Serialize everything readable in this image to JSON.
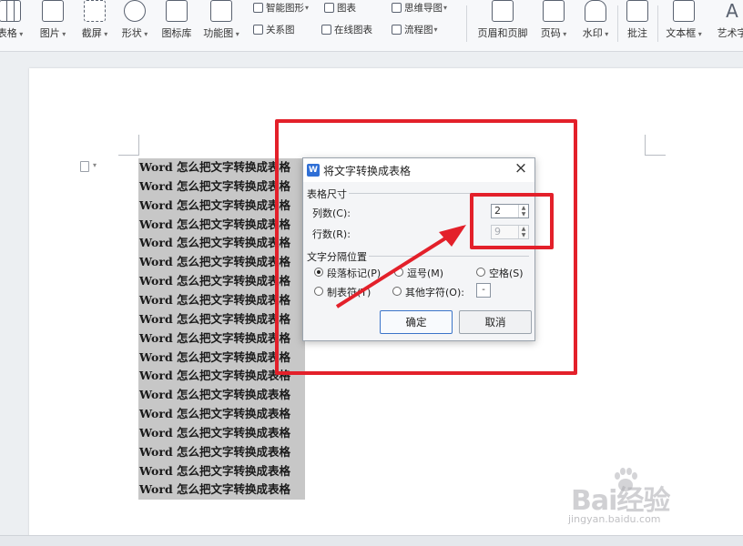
{
  "ribbon": {
    "items": [
      {
        "label": "表格",
        "icon": "table-icon"
      },
      {
        "label": "图片",
        "icon": "picture-icon"
      },
      {
        "label": "截屏",
        "icon": "screenshot-icon"
      },
      {
        "label": "形状",
        "icon": "shapes-icon"
      },
      {
        "label": "图标库",
        "icon": "icon-library-icon"
      },
      {
        "label": "功能图",
        "icon": "function-chart-icon"
      },
      {
        "label": "页眉和页脚",
        "icon": "header-footer-icon"
      },
      {
        "label": "页码",
        "icon": "page-number-icon"
      },
      {
        "label": "水印",
        "icon": "watermark-icon"
      },
      {
        "label": "批注",
        "icon": "comment-icon"
      },
      {
        "label": "文本框",
        "icon": "textbox-icon"
      },
      {
        "label": "艺术字",
        "icon": "wordart-icon"
      }
    ],
    "small": {
      "smart_graphic": "智能图形",
      "chart": "图表",
      "mind_map": "思维导图",
      "relation_chart": "关系图",
      "online_chart": "在线图表",
      "flowchart": "流程图"
    }
  },
  "document": {
    "line_text": "Word 怎么把文字转换成表格",
    "line_count": 18
  },
  "dialog": {
    "app_icon_text": "W",
    "title": "将文字转换成表格",
    "close": "×",
    "table_size_group": "表格尺寸",
    "columns_label": "列数(C):",
    "columns_value": "2",
    "rows_label": "行数(R):",
    "rows_value": "9",
    "separator_group": "文字分隔位置",
    "separators": {
      "paragraph": "段落标记(P)",
      "comma": "逗号(M)",
      "space": "空格(S)",
      "tab": "制表符(T)",
      "other": "其他字符(O):"
    },
    "selected_separator": "paragraph",
    "other_char": "-",
    "ok": "确定",
    "cancel": "取消"
  },
  "annotation_color": "#e3202a",
  "watermark": {
    "brand": "Bai经验",
    "url": "jingyan.baidu.com"
  }
}
